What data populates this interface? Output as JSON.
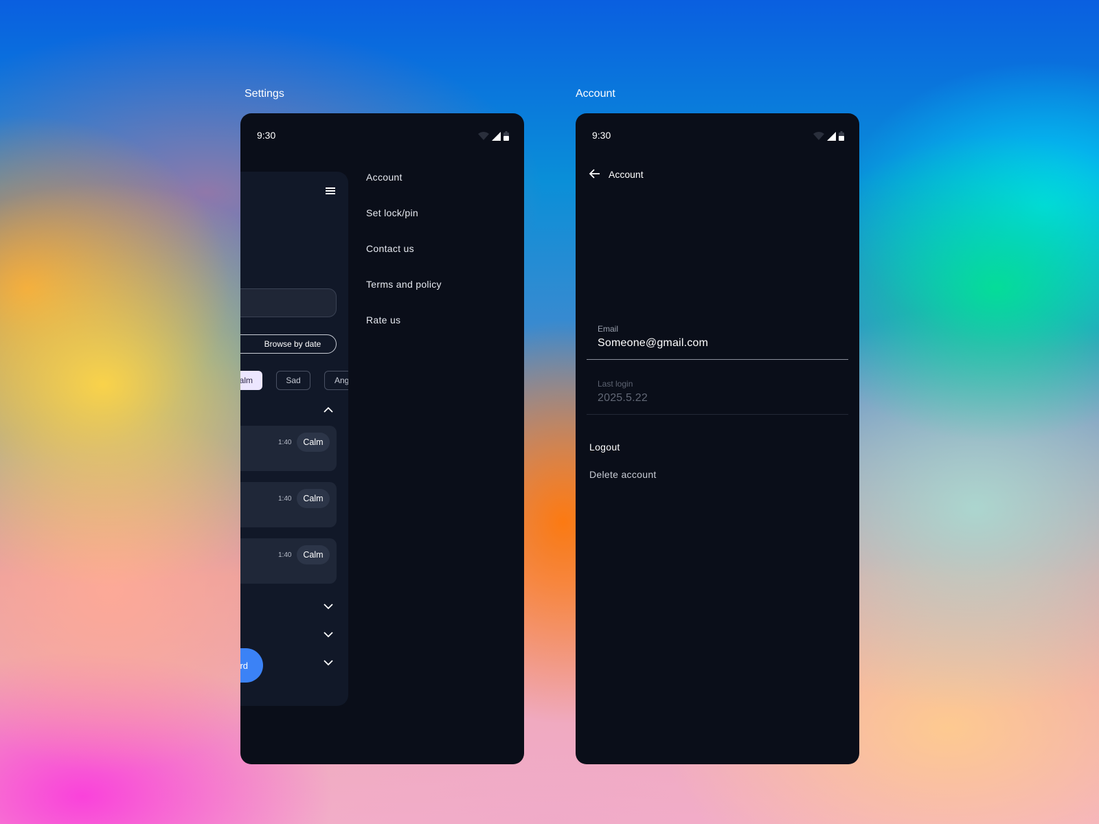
{
  "settings_screen": {
    "label": "Settings",
    "status_time": "9:30",
    "browse_label": "Browse by date",
    "mood_chips": [
      "alm",
      "Sad",
      "Ang"
    ],
    "entries": [
      {
        "time": "1:40",
        "tag": "Calm"
      },
      {
        "time": "1:40",
        "tag": "Calm"
      },
      {
        "time": "1:40",
        "tag": "Calm"
      }
    ],
    "fab_label": "rd",
    "drawer_items": [
      "Account",
      "Set lock/pin",
      "Contact us",
      "Terms and policy",
      "Rate us"
    ]
  },
  "account_screen": {
    "label": "Account",
    "status_time": "9:30",
    "title": "Account",
    "email": {
      "label": "Email",
      "value": "Someone@gmail.com"
    },
    "last_login": {
      "label": "Last login",
      "value": "2025.5.22"
    },
    "actions": [
      "Logout",
      "Delete account"
    ]
  },
  "colors": {
    "surface": "#0a0e19",
    "panel": "#111828",
    "card": "#1f2738",
    "accent": "#3b82f6",
    "chip_selected": "#ece6ff"
  },
  "icons": [
    "wifi-icon",
    "signal-icon",
    "battery-icon",
    "menu-icon",
    "chevron-up-icon",
    "chevron-down-icon",
    "arrow-back-icon"
  ]
}
